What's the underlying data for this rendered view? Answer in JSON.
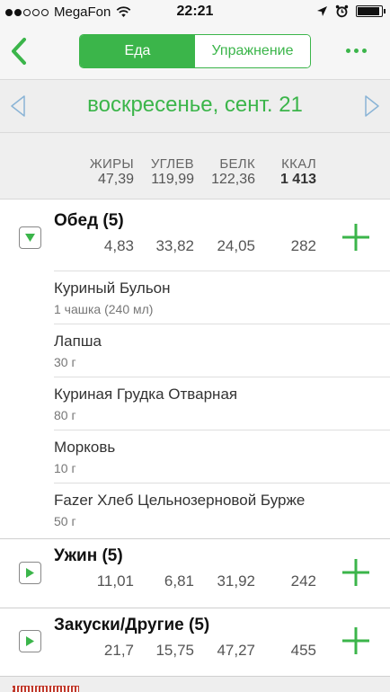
{
  "status_bar": {
    "carrier": "MegaFon",
    "time": "22:21",
    "signal_dots_filled": 2,
    "signal_dots_total": 5,
    "battery_level": 0.85
  },
  "nav": {
    "tabs": [
      {
        "label": "Еда",
        "active": true
      },
      {
        "label": "Упражнение",
        "active": false
      }
    ],
    "accent_color": "#3bb54a"
  },
  "date": {
    "label": "воскресенье, сент. 21"
  },
  "totals": {
    "fat": {
      "label": "ЖИРЫ",
      "value": "47,39"
    },
    "carbs": {
      "label": "УГЛЕВ",
      "value": "119,99"
    },
    "protein": {
      "label": "БЕЛК",
      "value": "122,36"
    },
    "kcal": {
      "label": "ККАЛ",
      "value": "1 413"
    }
  },
  "meals": [
    {
      "name": "Обед (5)",
      "expanded": true,
      "fat": "4,83",
      "carbs": "33,82",
      "protein": "24,05",
      "kcal": "282",
      "foods": [
        {
          "name": "Куриный Бульон",
          "serving": "1 чашка (240 мл)"
        },
        {
          "name": "Лапша",
          "serving": "30 г"
        },
        {
          "name": "Куриная Грудка Отварная",
          "serving": "80 г"
        },
        {
          "name": "Морковь",
          "serving": "10 г"
        },
        {
          "name": "Fazer Хлеб Цельнозерновой Бурже",
          "serving": "50 г"
        }
      ]
    },
    {
      "name": "Ужин (5)",
      "expanded": false,
      "fat": "11,01",
      "carbs": "6,81",
      "protein": "31,92",
      "kcal": "242"
    },
    {
      "name": "Закуски/Другие (5)",
      "expanded": false,
      "fat": "21,7",
      "carbs": "15,75",
      "protein": "47,27",
      "kcal": "455"
    }
  ]
}
